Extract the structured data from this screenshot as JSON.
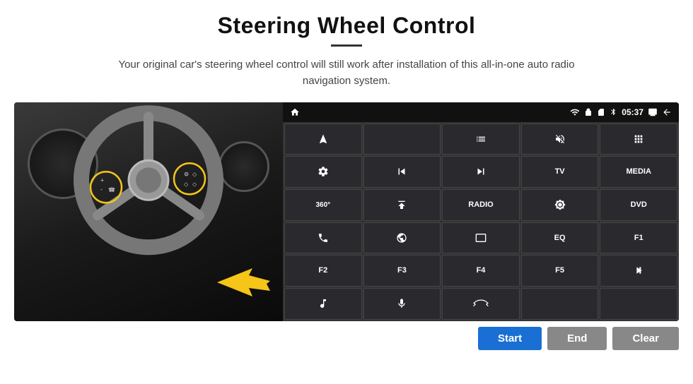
{
  "page": {
    "title": "Steering Wheel Control",
    "subtitle": "Your original car's steering wheel control will still work after installation of this all-in-one auto radio navigation system."
  },
  "status_bar": {
    "time": "05:37"
  },
  "buttons": {
    "grid": [
      {
        "id": "home",
        "type": "icon",
        "icon": "home",
        "text": ""
      },
      {
        "id": "nav",
        "type": "icon",
        "icon": "navigate",
        "text": ""
      },
      {
        "id": "list",
        "type": "icon",
        "icon": "list",
        "text": ""
      },
      {
        "id": "mute",
        "type": "icon",
        "icon": "mute",
        "text": ""
      },
      {
        "id": "apps",
        "type": "icon",
        "icon": "apps",
        "text": ""
      },
      {
        "id": "settings",
        "type": "icon",
        "icon": "settings",
        "text": ""
      },
      {
        "id": "prev",
        "type": "icon",
        "icon": "prev",
        "text": ""
      },
      {
        "id": "next",
        "type": "icon",
        "icon": "next",
        "text": ""
      },
      {
        "id": "tv",
        "type": "text",
        "text": "TV"
      },
      {
        "id": "media",
        "type": "text",
        "text": "MEDIA"
      },
      {
        "id": "360cam",
        "type": "icon",
        "icon": "360cam",
        "text": ""
      },
      {
        "id": "eject",
        "type": "icon",
        "icon": "eject",
        "text": ""
      },
      {
        "id": "radio",
        "type": "text",
        "text": "RADIO"
      },
      {
        "id": "brightness",
        "type": "icon",
        "icon": "brightness",
        "text": ""
      },
      {
        "id": "dvd",
        "type": "text",
        "text": "DVD"
      },
      {
        "id": "phone",
        "type": "icon",
        "icon": "phone",
        "text": ""
      },
      {
        "id": "browse",
        "type": "icon",
        "icon": "browse",
        "text": ""
      },
      {
        "id": "screen",
        "type": "icon",
        "icon": "screen",
        "text": ""
      },
      {
        "id": "eq",
        "type": "text",
        "text": "EQ"
      },
      {
        "id": "f1",
        "type": "text",
        "text": "F1"
      },
      {
        "id": "f2",
        "type": "text",
        "text": "F2"
      },
      {
        "id": "f3",
        "type": "text",
        "text": "F3"
      },
      {
        "id": "f4",
        "type": "text",
        "text": "F4"
      },
      {
        "id": "f5",
        "type": "text",
        "text": "F5"
      },
      {
        "id": "playpause",
        "type": "icon",
        "icon": "playpause",
        "text": ""
      },
      {
        "id": "music",
        "type": "icon",
        "icon": "music",
        "text": ""
      },
      {
        "id": "mic",
        "type": "icon",
        "icon": "mic",
        "text": ""
      },
      {
        "id": "answer",
        "type": "icon",
        "icon": "answer",
        "text": ""
      },
      {
        "id": "empty1",
        "type": "text",
        "text": ""
      },
      {
        "id": "empty2",
        "type": "text",
        "text": ""
      }
    ],
    "start": "Start",
    "end": "End",
    "clear": "Clear"
  }
}
